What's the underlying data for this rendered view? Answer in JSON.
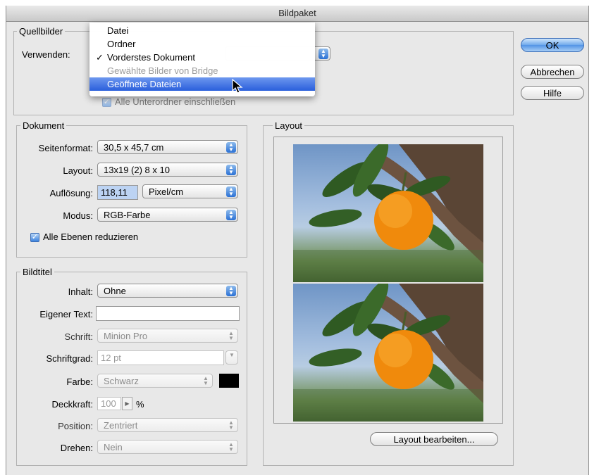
{
  "window": {
    "title": "Bildpaket"
  },
  "source": {
    "legend": "Quellbilder",
    "use_label": "Verwenden:",
    "include_subfolders": "Alle Unterordner einschließen"
  },
  "menu": {
    "items": [
      {
        "label": "Datei",
        "state": "normal"
      },
      {
        "label": "Ordner",
        "state": "normal"
      },
      {
        "label": "Vorderstes Dokument",
        "state": "checked"
      },
      {
        "label": "Gewählte Bilder von Bridge",
        "state": "disabled"
      },
      {
        "label": "Geöffnete Dateien",
        "state": "highlighted"
      }
    ],
    "check_mark": "✓"
  },
  "buttons": {
    "ok": "OK",
    "cancel": "Abbrechen",
    "help": "Hilfe",
    "edit_layout": "Layout bearbeiten..."
  },
  "document": {
    "legend": "Dokument",
    "page_size_label": "Seitenformat:",
    "page_size_value": "30,5 x 45,7 cm",
    "layout_label": "Layout:",
    "layout_value": "13x19 (2) 8 x 10",
    "resolution_label": "Auflösung:",
    "resolution_value": "118,11",
    "resolution_unit": "Pixel/cm",
    "mode_label": "Modus:",
    "mode_value": "RGB-Farbe",
    "flatten_label": "Alle Ebenen reduzieren",
    "flatten_checked": true
  },
  "caption": {
    "legend": "Bildtitel",
    "content_label": "Inhalt:",
    "content_value": "Ohne",
    "custom_text_label": "Eigener Text:",
    "custom_text_value": "",
    "font_label": "Schrift:",
    "font_value": "Minion Pro",
    "font_size_label": "Schriftgrad:",
    "font_size_value": "12 pt",
    "color_label": "Farbe:",
    "color_value": "Schwarz",
    "color_swatch": "#000000",
    "opacity_label": "Deckkraft:",
    "opacity_value": "100",
    "opacity_unit": "%",
    "position_label": "Position:",
    "position_value": "Zentriert",
    "rotate_label": "Drehen:",
    "rotate_value": "Nein"
  },
  "layout_panel": {
    "legend": "Layout"
  },
  "colors": {
    "accent": "#2a5fdc",
    "window_bg": "#e8e8e8"
  }
}
